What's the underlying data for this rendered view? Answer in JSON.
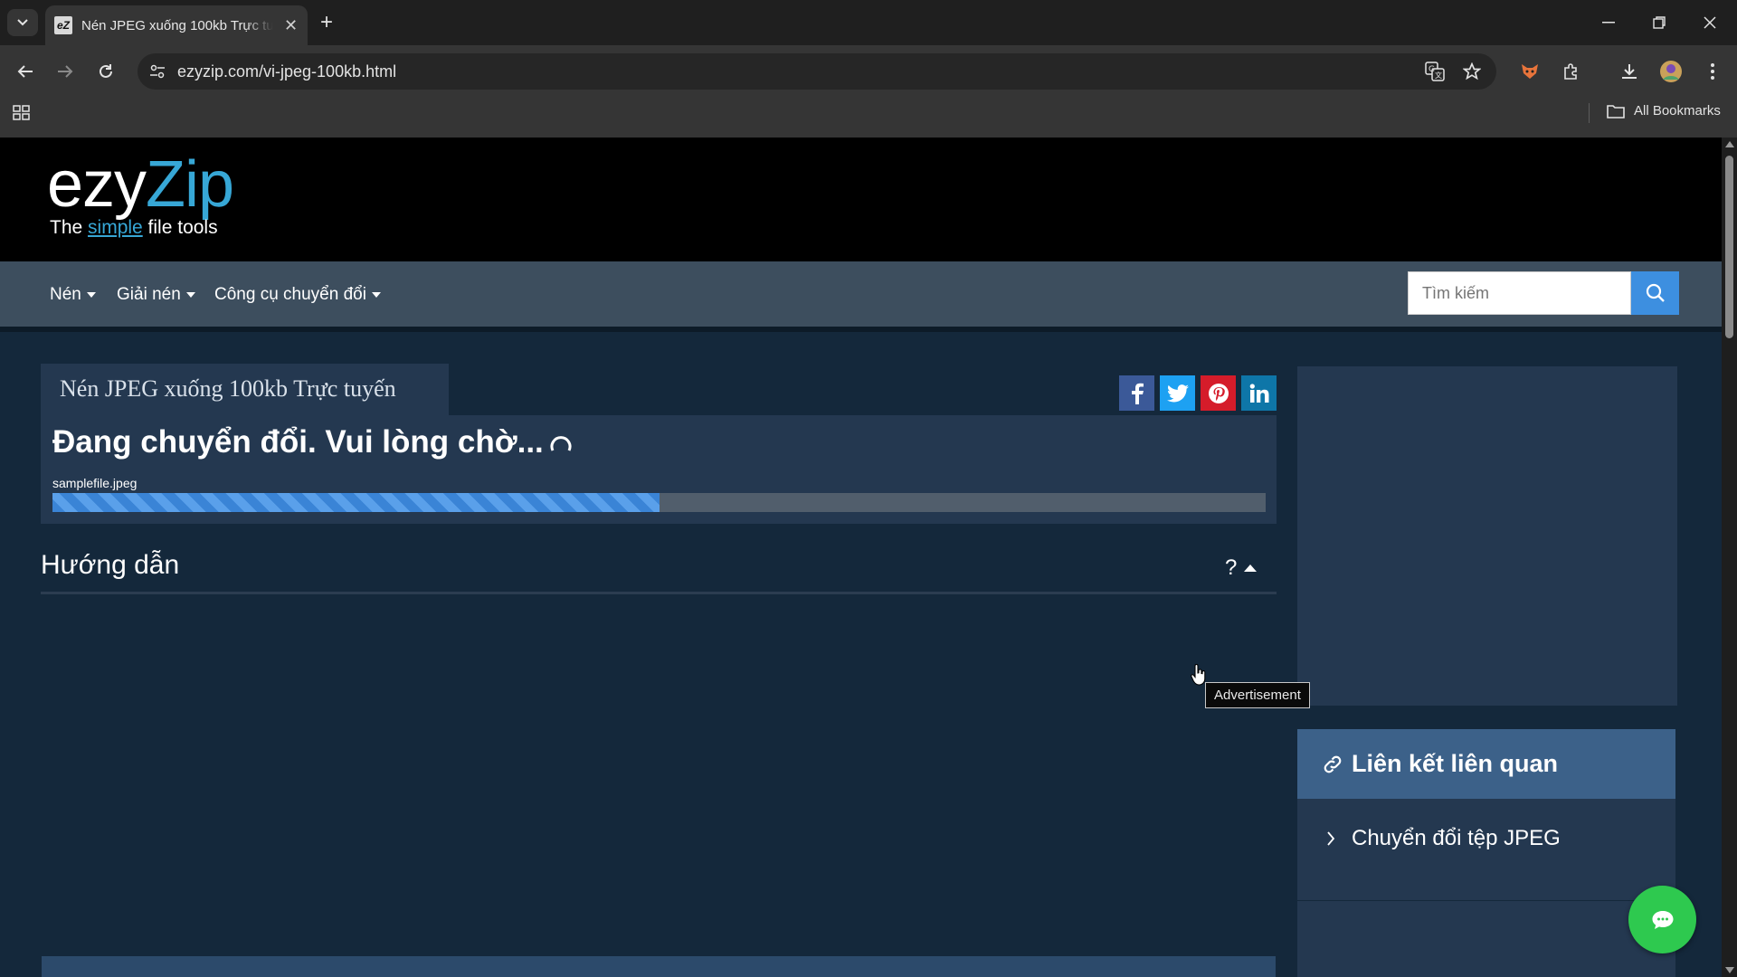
{
  "browser": {
    "tab": {
      "favicon_text": "eZ",
      "title": "Nén JPEG xuống 100kb Trực tuyến"
    },
    "url": "ezyzip.com/vi-jpeg-100kb.html",
    "bookmarks": {
      "all_label": "All Bookmarks"
    }
  },
  "site": {
    "logo": {
      "main_part1": "ezy",
      "main_part2": "Zip",
      "tag_before": "The ",
      "tag_highlight": "simple",
      "tag_after": " file tools"
    },
    "nav": {
      "items": [
        "Nén",
        "Giải nén",
        "Công cụ chuyển đổi"
      ]
    },
    "search": {
      "placeholder": "Tìm kiếm"
    }
  },
  "main": {
    "page_title": "Nén JPEG xuống 100kb Trực tuyến",
    "share": [
      "facebook",
      "twitter",
      "pinterest",
      "linkedin"
    ],
    "status": "Đang chuyển đổi. Vui lòng chờ...",
    "file": {
      "name": "samplefile.jpeg",
      "progress": 0.5
    },
    "guide": {
      "title": "Hướng dẫn",
      "toggle": "?"
    }
  },
  "sidebar": {
    "tooltip": "Advertisement",
    "related": {
      "heading": "Liên kết liên quan",
      "items": [
        "Chuyển đổi tệp JPEG"
      ]
    }
  },
  "colors": {
    "accent": "#37a7d6",
    "progress": "#3a84d6",
    "chat": "#2ec94f"
  }
}
